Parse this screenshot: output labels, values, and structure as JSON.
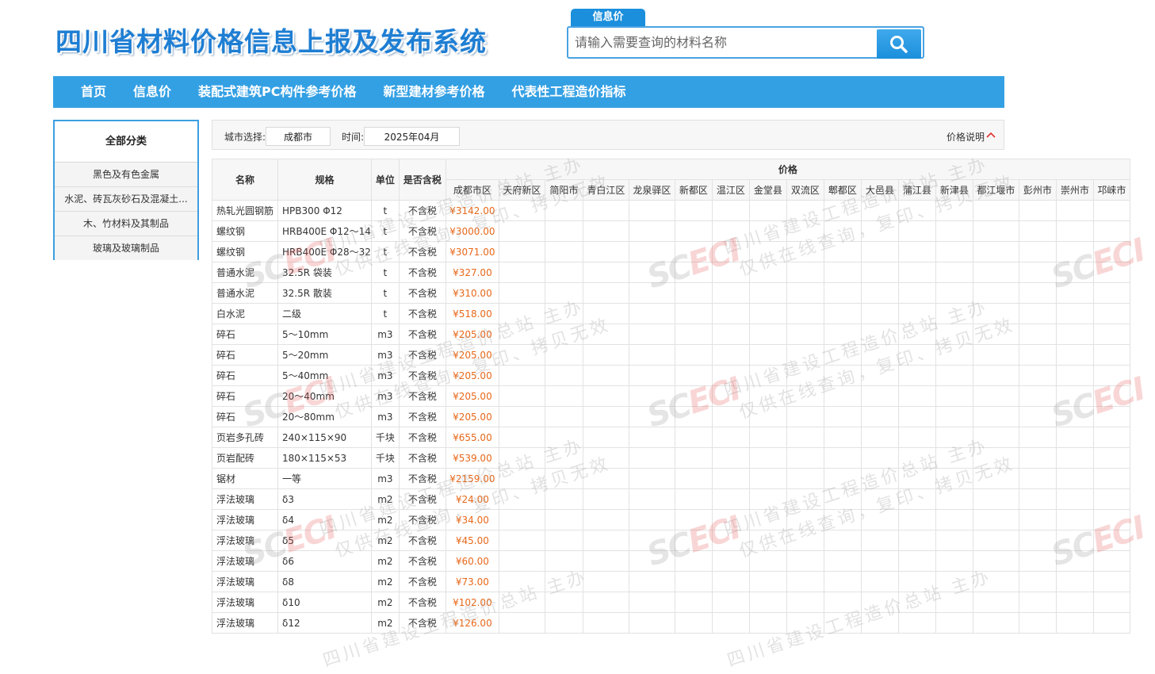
{
  "header": {
    "site_title": "四川省材料价格信息上报及发布系统",
    "search_tab": "信息价",
    "search_placeholder": "请输入需要查询的材料名称"
  },
  "nav": {
    "items": [
      "首页",
      "信息价",
      "装配式建筑PC构件参考价格",
      "新型建材参考价格",
      "代表性工程造价指标"
    ]
  },
  "sidebar": {
    "title": "全部分类",
    "items": [
      "黑色及有色金属",
      "水泥、砖瓦灰砂石及混凝土...",
      "木、竹材料及其制品",
      "玻璃及玻璃制品"
    ]
  },
  "filter": {
    "city_label": "城市选择:",
    "city_value": "成都市",
    "time_label": "时间:",
    "time_value": "2025年04月",
    "price_note": "价格说明"
  },
  "table": {
    "headers": {
      "name": "名称",
      "spec": "规格",
      "unit": "单位",
      "tax": "是否含税",
      "price": "价格"
    },
    "cities": [
      "成都市区",
      "天府新区",
      "简阳市",
      "青白江区",
      "龙泉驿区",
      "新都区",
      "温江区",
      "金堂县",
      "双流区",
      "郫都区",
      "大邑县",
      "蒲江县",
      "新津县",
      "都江堰市",
      "彭州市",
      "崇州市",
      "邛崃市"
    ],
    "rows": [
      {
        "name": "热轧光圆钢筋",
        "spec": "HPB300 Φ12",
        "unit": "t",
        "tax": "不含税",
        "price": "¥3142.00"
      },
      {
        "name": "螺纹钢",
        "spec": "HRB400E Φ12～14",
        "unit": "t",
        "tax": "不含税",
        "price": "¥3000.00"
      },
      {
        "name": "螺纹钢",
        "spec": "HRB400E Φ28～32",
        "unit": "t",
        "tax": "不含税",
        "price": "¥3071.00"
      },
      {
        "name": "普通水泥",
        "spec": "32.5R 袋装",
        "unit": "t",
        "tax": "不含税",
        "price": "¥327.00"
      },
      {
        "name": "普通水泥",
        "spec": "32.5R 散装",
        "unit": "t",
        "tax": "不含税",
        "price": "¥310.00"
      },
      {
        "name": "白水泥",
        "spec": "二级",
        "unit": "t",
        "tax": "不含税",
        "price": "¥518.00"
      },
      {
        "name": "碎石",
        "spec": "5～10mm",
        "unit": "m3",
        "tax": "不含税",
        "price": "¥205.00"
      },
      {
        "name": "碎石",
        "spec": "5～20mm",
        "unit": "m3",
        "tax": "不含税",
        "price": "¥205.00"
      },
      {
        "name": "碎石",
        "spec": "5～40mm",
        "unit": "m3",
        "tax": "不含税",
        "price": "¥205.00"
      },
      {
        "name": "碎石",
        "spec": "20～40mm",
        "unit": "m3",
        "tax": "不含税",
        "price": "¥205.00"
      },
      {
        "name": "碎石",
        "spec": "20～80mm",
        "unit": "m3",
        "tax": "不含税",
        "price": "¥205.00"
      },
      {
        "name": "页岩多孔砖",
        "spec": "240×115×90",
        "unit": "千块",
        "tax": "不含税",
        "price": "¥655.00"
      },
      {
        "name": "页岩配砖",
        "spec": "180×115×53",
        "unit": "千块",
        "tax": "不含税",
        "price": "¥539.00"
      },
      {
        "name": "锯材",
        "spec": "一等",
        "unit": "m3",
        "tax": "不含税",
        "price": "¥2159.00"
      },
      {
        "name": "浮法玻璃",
        "spec": "δ3",
        "unit": "m2",
        "tax": "不含税",
        "price": "¥24.00"
      },
      {
        "name": "浮法玻璃",
        "spec": "δ4",
        "unit": "m2",
        "tax": "不含税",
        "price": "¥34.00"
      },
      {
        "name": "浮法玻璃",
        "spec": "δ5",
        "unit": "m2",
        "tax": "不含税",
        "price": "¥45.00"
      },
      {
        "name": "浮法玻璃",
        "spec": "δ6",
        "unit": "m2",
        "tax": "不含税",
        "price": "¥60.00"
      },
      {
        "name": "浮法玻璃",
        "spec": "δ8",
        "unit": "m2",
        "tax": "不含税",
        "price": "¥73.00"
      },
      {
        "name": "浮法玻璃",
        "spec": "δ10",
        "unit": "m2",
        "tax": "不含税",
        "price": "¥102.00"
      },
      {
        "name": "浮法玻璃",
        "spec": "δ12",
        "unit": "m2",
        "tax": "不含税",
        "price": "¥126.00"
      }
    ]
  },
  "watermark": {
    "line1": "四川省建设工程造价总站 主办",
    "line2": "仅供在线查询，复印、拷贝无效",
    "logo_a": "SC",
    "logo_b": "ECI"
  },
  "colors": {
    "accent": "#34a0e4",
    "title": "#1e7ed3",
    "price": "#e8681a"
  }
}
